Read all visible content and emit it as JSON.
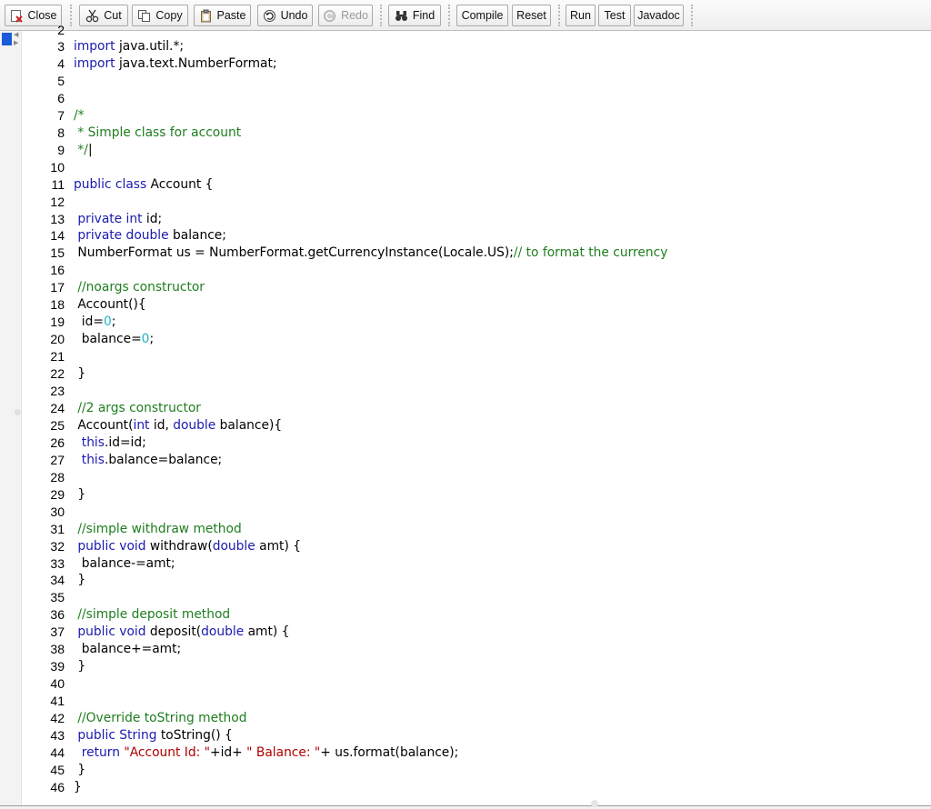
{
  "toolbar": {
    "close": "Close",
    "cut": "Cut",
    "copy": "Copy",
    "paste": "Paste",
    "undo": "Undo",
    "redo": "Redo",
    "find": "Find",
    "compile": "Compile",
    "reset": "Reset",
    "run": "Run",
    "test": "Test",
    "javadoc": "Javadoc"
  },
  "editor": {
    "first_line_partial": "2",
    "lines": [
      {
        "n": "3",
        "parts": [
          {
            "t": "kw",
            "v": "import"
          },
          {
            "t": "",
            "v": " java.util.*;"
          }
        ]
      },
      {
        "n": "4",
        "parts": [
          {
            "t": "kw",
            "v": "import"
          },
          {
            "t": "",
            "v": " java.text.NumberFormat;"
          }
        ]
      },
      {
        "n": "5",
        "parts": []
      },
      {
        "n": "6",
        "parts": []
      },
      {
        "n": "7",
        "parts": [
          {
            "t": "cm",
            "v": "/*"
          }
        ]
      },
      {
        "n": "8",
        "parts": [
          {
            "t": "cm",
            "v": " * Simple class for account"
          }
        ]
      },
      {
        "n": "9",
        "parts": [
          {
            "t": "cm",
            "v": " */"
          },
          {
            "t": "caret",
            "v": "|"
          }
        ]
      },
      {
        "n": "10",
        "parts": []
      },
      {
        "n": "11",
        "parts": [
          {
            "t": "kw",
            "v": "public class"
          },
          {
            "t": "",
            "v": " Account {"
          }
        ]
      },
      {
        "n": "12",
        "parts": []
      },
      {
        "n": "13",
        "parts": [
          {
            "t": "",
            "v": " "
          },
          {
            "t": "kw",
            "v": "private int"
          },
          {
            "t": "",
            "v": " id;"
          }
        ]
      },
      {
        "n": "14",
        "parts": [
          {
            "t": "",
            "v": " "
          },
          {
            "t": "kw",
            "v": "private double"
          },
          {
            "t": "",
            "v": " balance;"
          }
        ]
      },
      {
        "n": "15",
        "parts": [
          {
            "t": "",
            "v": " NumberFormat us = NumberFormat.getCurrencyInstance(Locale.US);"
          },
          {
            "t": "cm",
            "v": "// to format the currency"
          }
        ]
      },
      {
        "n": "16",
        "parts": []
      },
      {
        "n": "17",
        "parts": [
          {
            "t": "",
            "v": " "
          },
          {
            "t": "cm",
            "v": "//noargs constructor"
          }
        ]
      },
      {
        "n": "18",
        "parts": [
          {
            "t": "",
            "v": " Account(){"
          }
        ]
      },
      {
        "n": "19",
        "parts": [
          {
            "t": "",
            "v": "  id="
          },
          {
            "t": "num",
            "v": "0"
          },
          {
            "t": "",
            "v": ";"
          }
        ]
      },
      {
        "n": "20",
        "parts": [
          {
            "t": "",
            "v": "  balance="
          },
          {
            "t": "num",
            "v": "0"
          },
          {
            "t": "",
            "v": ";"
          }
        ]
      },
      {
        "n": "21",
        "parts": []
      },
      {
        "n": "22",
        "parts": [
          {
            "t": "",
            "v": " }"
          }
        ]
      },
      {
        "n": "23",
        "parts": []
      },
      {
        "n": "24",
        "parts": [
          {
            "t": "",
            "v": " "
          },
          {
            "t": "cm",
            "v": "//2 args constructor"
          }
        ]
      },
      {
        "n": "25",
        "parts": [
          {
            "t": "",
            "v": " Account("
          },
          {
            "t": "kw",
            "v": "int"
          },
          {
            "t": "",
            "v": " id, "
          },
          {
            "t": "kw",
            "v": "double"
          },
          {
            "t": "",
            "v": " balance){"
          }
        ]
      },
      {
        "n": "26",
        "parts": [
          {
            "t": "",
            "v": "  "
          },
          {
            "t": "kw",
            "v": "this"
          },
          {
            "t": "",
            "v": ".id=id;"
          }
        ]
      },
      {
        "n": "27",
        "parts": [
          {
            "t": "",
            "v": "  "
          },
          {
            "t": "kw",
            "v": "this"
          },
          {
            "t": "",
            "v": ".balance=balance;"
          }
        ]
      },
      {
        "n": "28",
        "parts": []
      },
      {
        "n": "29",
        "parts": [
          {
            "t": "",
            "v": " }"
          }
        ]
      },
      {
        "n": "30",
        "parts": []
      },
      {
        "n": "31",
        "parts": [
          {
            "t": "",
            "v": " "
          },
          {
            "t": "cm",
            "v": "//simple withdraw method"
          }
        ]
      },
      {
        "n": "32",
        "parts": [
          {
            "t": "",
            "v": " "
          },
          {
            "t": "kw",
            "v": "public void"
          },
          {
            "t": "",
            "v": " withdraw("
          },
          {
            "t": "kw",
            "v": "double"
          },
          {
            "t": "",
            "v": " amt) {"
          }
        ]
      },
      {
        "n": "33",
        "parts": [
          {
            "t": "",
            "v": "  balance-=amt;"
          }
        ]
      },
      {
        "n": "34",
        "parts": [
          {
            "t": "",
            "v": " }"
          }
        ]
      },
      {
        "n": "35",
        "parts": []
      },
      {
        "n": "36",
        "parts": [
          {
            "t": "",
            "v": " "
          },
          {
            "t": "cm",
            "v": "//simple deposit method"
          }
        ]
      },
      {
        "n": "37",
        "parts": [
          {
            "t": "",
            "v": " "
          },
          {
            "t": "kw",
            "v": "public void"
          },
          {
            "t": "",
            "v": " deposit("
          },
          {
            "t": "kw",
            "v": "double"
          },
          {
            "t": "",
            "v": " amt) {"
          }
        ]
      },
      {
        "n": "38",
        "parts": [
          {
            "t": "",
            "v": "  balance+=amt;"
          }
        ]
      },
      {
        "n": "39",
        "parts": [
          {
            "t": "",
            "v": " }"
          }
        ]
      },
      {
        "n": "40",
        "parts": []
      },
      {
        "n": "41",
        "parts": []
      },
      {
        "n": "42",
        "parts": [
          {
            "t": "",
            "v": " "
          },
          {
            "t": "cm",
            "v": "//Override toString method"
          }
        ]
      },
      {
        "n": "43",
        "parts": [
          {
            "t": "",
            "v": " "
          },
          {
            "t": "kw",
            "v": "public"
          },
          {
            "t": "",
            "v": " "
          },
          {
            "t": "kw",
            "v": "String"
          },
          {
            "t": "",
            "v": " toString() {"
          }
        ]
      },
      {
        "n": "44",
        "parts": [
          {
            "t": "",
            "v": "  "
          },
          {
            "t": "kw",
            "v": "return"
          },
          {
            "t": "",
            "v": " "
          },
          {
            "t": "str",
            "v": "\"Account Id: \""
          },
          {
            "t": "",
            "v": "+id+ "
          },
          {
            "t": "str",
            "v": "\" Balance: \""
          },
          {
            "t": "",
            "v": "+ us.format(balance);"
          }
        ]
      },
      {
        "n": "45",
        "parts": [
          {
            "t": "",
            "v": " }"
          }
        ]
      },
      {
        "n": "46",
        "parts": [
          {
            "t": "",
            "v": "}"
          }
        ]
      }
    ]
  }
}
